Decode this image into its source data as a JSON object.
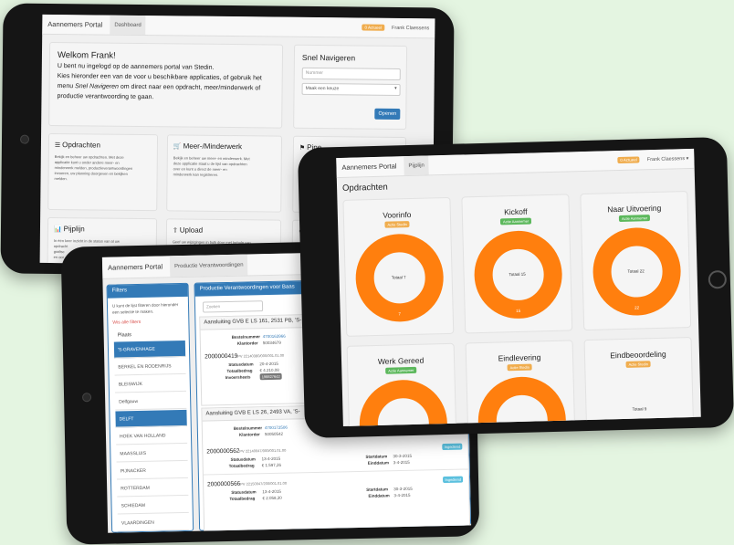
{
  "tablet1": {
    "brand": "Aannemers Portal",
    "tab": "Dashboard",
    "badge": "0 Actueel",
    "user": "Frank Claessens",
    "welcome": {
      "title": "Welkom Frank!",
      "line1": "U bent nu ingelogd op de aannemers portal van Stedin.",
      "line2": "Kies hieronder een van de voor u beschikbare applicaties, of gebruik het",
      "line3a": "menu ",
      "line3b": "Snel Navigeren",
      "line3c": " om direct naar een opdracht, meer/minderwerk of",
      "line4": "productie verantwoording te gaan."
    },
    "quicknav": {
      "title": "Snel Navigeren",
      "placeholder": "Nummer",
      "select": "Maak een keuze",
      "button": "Openen"
    },
    "tiles": [
      {
        "title": "Opdrachten",
        "l1": "Bekijk en beheer uw opdrachten. Met deze",
        "l2": "applicatie kunt u onder andere meer- en",
        "l3": "minderwerk melden, productieverantwoordingen",
        "l4": "invoeren, uw planning doorgeven en bekijken",
        "l5": "melden."
      },
      {
        "title": "Meer-/Minderwerk",
        "l1": "Bekijk en beheer uw meer- en minderwerk. Met",
        "l2": "deze applicatie staat u de lijst van opdrachten",
        "l3": "over en kunt u direct de meer- en",
        "l4": "minderwerk kan registreren.",
        "l5": ""
      },
      {
        "title": "Pipe"
      },
      {
        "title": "Pijplijn",
        "l1": "In één keer inzicht in de status van al uw",
        "l2": "opdracht",
        "l3": "grafisc",
        "l4": "en oor"
      },
      {
        "title": "Upload",
        "l1": "Geef uw wijzigingen in bulk door met behulp van",
        "l2": "een"
      }
    ]
  },
  "tablet2": {
    "brand": "Aannemers Portal",
    "tab": "Pijplijn",
    "badge": "0 Actueel",
    "user": "Frank Claessens ▾",
    "heading": "Opdrachten",
    "cards": [
      {
        "title": "Voorinfo",
        "badge": "Actie Stedin",
        "badgeColor": "#f0ad4e",
        "center": "Totaal 7",
        "bottom": "7"
      },
      {
        "title": "Kickoff",
        "badge": "Actie Aannemer",
        "badgeColor": "#5cb85c",
        "center": "Totaal 15",
        "bottom": "15"
      },
      {
        "title": "Naar Uitvoering",
        "badge": "Actie Aannemer",
        "badgeColor": "#5cb85c",
        "center": "Totaal 22",
        "bottom": "22"
      },
      {
        "title": "Werk Gereed",
        "badge": "Actie Aannemer",
        "badgeColor": "#5cb85c",
        "center": "",
        "bottom": ""
      },
      {
        "title": "Eindlevering",
        "badge": "Actie Stedin",
        "badgeColor": "#f0ad4e",
        "center": "",
        "bottom": ""
      },
      {
        "title": "Eindbeoordeling",
        "badge": "Actie Stedin",
        "badgeColor": "#f0ad4e",
        "center": "Totaal 9",
        "bottom": ""
      }
    ],
    "donutColor": "#ff7f0e"
  },
  "tablet3": {
    "brand": "Aannemers Portal",
    "tab": "Productie Verantwoordingen",
    "filters": {
      "header": "Filters",
      "help1": "U kunt de lijst filteren door hieronder",
      "help2": "een selectie te maken.",
      "wis": "Wis alle filters",
      "group": "Plaats",
      "items": [
        "'S-GRAVENHAGE",
        "BERKEL EN RODENRIJS",
        "BLEISWIJK",
        "Delfgauw",
        "DELFT",
        "HOEK VAN HOLLAND",
        "MAASSLUIS",
        "PIJNACKER",
        "ROTTERDAM",
        "SCHIEDAM",
        "VLAARDINGEN"
      ],
      "selected": [
        0,
        4
      ]
    },
    "main": {
      "header": "Productie Verantwoordingen voor Baas",
      "search_placeholder": "Zoeken",
      "groups": [
        {
          "title": "Aansluiting GVB E LS 161, 2531 PB, 'S-",
          "bestel_label": "Bestelnummer",
          "bestel": "4700163966",
          "klant_label": "Klantorder",
          "klant": "50034679",
          "item": {
            "num": "2000000419",
            "pv": "PV 22140380/000/001.01.00",
            "status_label": "Statusdatum",
            "status": "20-4-2015",
            "totaal_label": "Totaalbedrag",
            "totaal": "€ 4.210,08",
            "invoer_label": "Invoersheets",
            "invoer": "198827642"
          }
        },
        {
          "title": "Aansluiting GVB E LS 26, 2493 VA, 'S-",
          "bestel_label": "Bestelnummer",
          "bestel": "4700172506",
          "klant_label": "Klantorder",
          "klant": "50050542",
          "items": [
            {
              "num": "2000000562",
              "pv": "PV 22140047/000/001.01.00",
              "status_label": "Statusdatum",
              "status": "13-4-2015",
              "totaal_label": "Totaalbedrag",
              "totaal": "€ 1.597,26",
              "start_label": "Startdatum",
              "start": "30-3-2015",
              "eind_label": "Einddatum",
              "eind": "3-4-2015",
              "tag": "Ingediend"
            },
            {
              "num": "2000000566",
              "pv": "PV 22150047/200/001.01.00",
              "status_label": "Statusdatum",
              "status": "13-4-2015",
              "totaal_label": "Totaalbedrag",
              "totaal": "€ 2.058,30",
              "start_label": "Startdatum",
              "start": "30-3-2015",
              "eind_label": "Einddatum",
              "eind": "3-4-2015",
              "tag": "Ingediend"
            }
          ]
        }
      ]
    }
  }
}
